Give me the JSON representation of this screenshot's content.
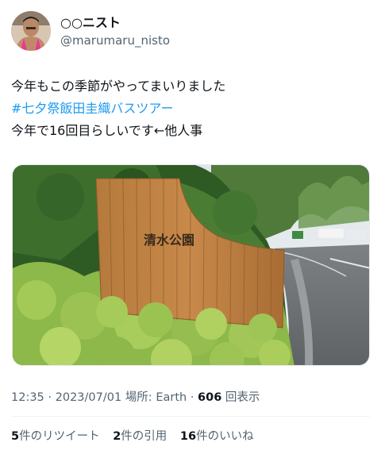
{
  "user": {
    "display_name": "○○ニスト",
    "handle": "@marumaru_nisto"
  },
  "tweet": {
    "line1": "今年もこの季節がやってまいりました",
    "hashtag": "#七夕祭飯田圭織バスツアー",
    "line3": "今年で16回目らしいです←他人事"
  },
  "photo": {
    "sign_text": "清水公園"
  },
  "meta": {
    "time": "12:35",
    "date": "2023/07/01",
    "location_label": "場所: ",
    "location": "Earth",
    "views_count": "606",
    "views_label": "回表示"
  },
  "stats": {
    "retweets_count": "5",
    "retweets_label": "件のリツイート",
    "quotes_count": "2",
    "quotes_label": "件の引用",
    "likes_count": "16",
    "likes_label": "件のいいね"
  },
  "colors": {
    "link": "#1d9bf0",
    "secondary_text": "#536471",
    "primary_text": "#0f1419"
  }
}
